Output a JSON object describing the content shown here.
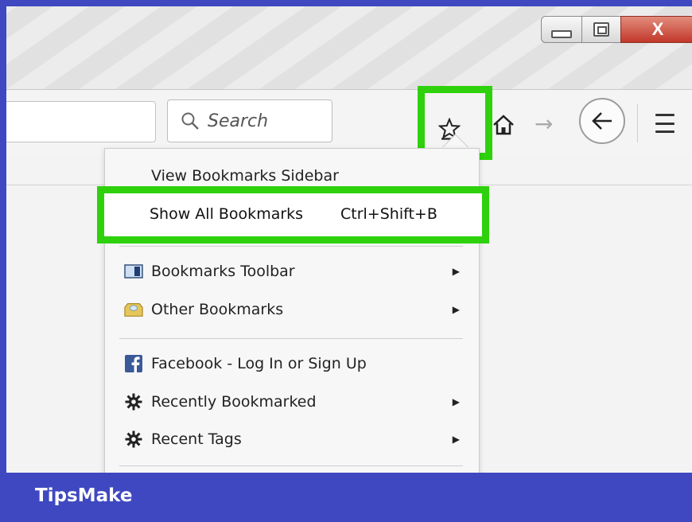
{
  "window": {
    "minimize_icon": "minimize-icon",
    "maximize_icon": "restore-icon",
    "close_glyph": "X"
  },
  "toolbar": {
    "search_placeholder": "Search",
    "star_icon": "bookmark-star-icon",
    "home_icon": "home-icon",
    "forward_glyph": "→",
    "back_icon": "back-arrow-icon",
    "menu_icon": "hamburger-menu-icon"
  },
  "bookmarks_menu": {
    "items": [
      {
        "label": "View Bookmarks Sidebar"
      },
      {
        "label": "Show All Bookmarks",
        "shortcut": "Ctrl+Shift+B",
        "highlighted": true
      },
      {
        "label": "Bookmarks Toolbar",
        "icon": "bookmarks-toolbar-icon",
        "submenu": true
      },
      {
        "label": "Other Bookmarks",
        "icon": "folder-icon",
        "submenu": true
      },
      {
        "label": "Facebook - Log In or Sign Up",
        "icon": "facebook-icon"
      },
      {
        "label": "Recently Bookmarked",
        "icon": "gear-icon",
        "submenu": true
      },
      {
        "label": "Recent Tags",
        "icon": "gear-icon",
        "submenu": true
      }
    ]
  },
  "footer": {
    "brand": "TipsMake"
  },
  "colors": {
    "highlight": "#2ed10c",
    "frame": "#3f48c0"
  }
}
